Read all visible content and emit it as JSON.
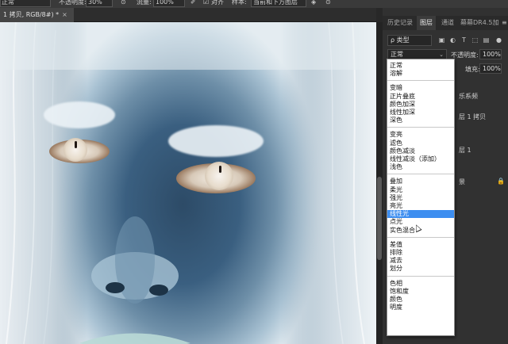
{
  "options_bar": {
    "mode_value": "正常",
    "opacity_label": "不透明度:",
    "opacity_value": "30%",
    "flow_label": "流量:",
    "flow_value": "100%",
    "align_label": "对齐",
    "sample_label": "样本:",
    "sample_value": "当前和下方图层"
  },
  "document": {
    "tab_title": "1 拷贝, RGB/8#) *",
    "close_glyph": "×"
  },
  "panel": {
    "tabs": [
      "历史记录",
      "图层",
      "通道",
      "幕幕DR4.5加"
    ],
    "active_tab": 1,
    "filter_kind": "ρ 类型",
    "blend_value": "正常",
    "opacity_label": "不透明度:",
    "opacity_value": "100%",
    "fill_label": "填充:",
    "fill_value": "100%",
    "layer_fragments": [
      "乐系频",
      "层 1 拷贝",
      "层 1",
      "景"
    ]
  },
  "blend_menu": {
    "groups": [
      [
        "正常",
        "溶解"
      ],
      [
        "变暗",
        "正片叠底",
        "颜色加深",
        "线性加深",
        "深色"
      ],
      [
        "变亮",
        "滤色",
        "颜色减淡",
        "线性减淡（添加）",
        "浅色"
      ],
      [
        "叠加",
        "柔光",
        "强光",
        "亮光",
        "线性光",
        "点光",
        "实色混合"
      ],
      [
        "差值",
        "排除",
        "减去",
        "划分"
      ],
      [
        "色相",
        "饱和度",
        "颜色",
        "明度"
      ]
    ],
    "selected": "线性光"
  },
  "colors": {
    "menu_highlight": "#3d8ef0",
    "panel_bg": "#313131",
    "canvas_shadow": "#2d4b67"
  }
}
